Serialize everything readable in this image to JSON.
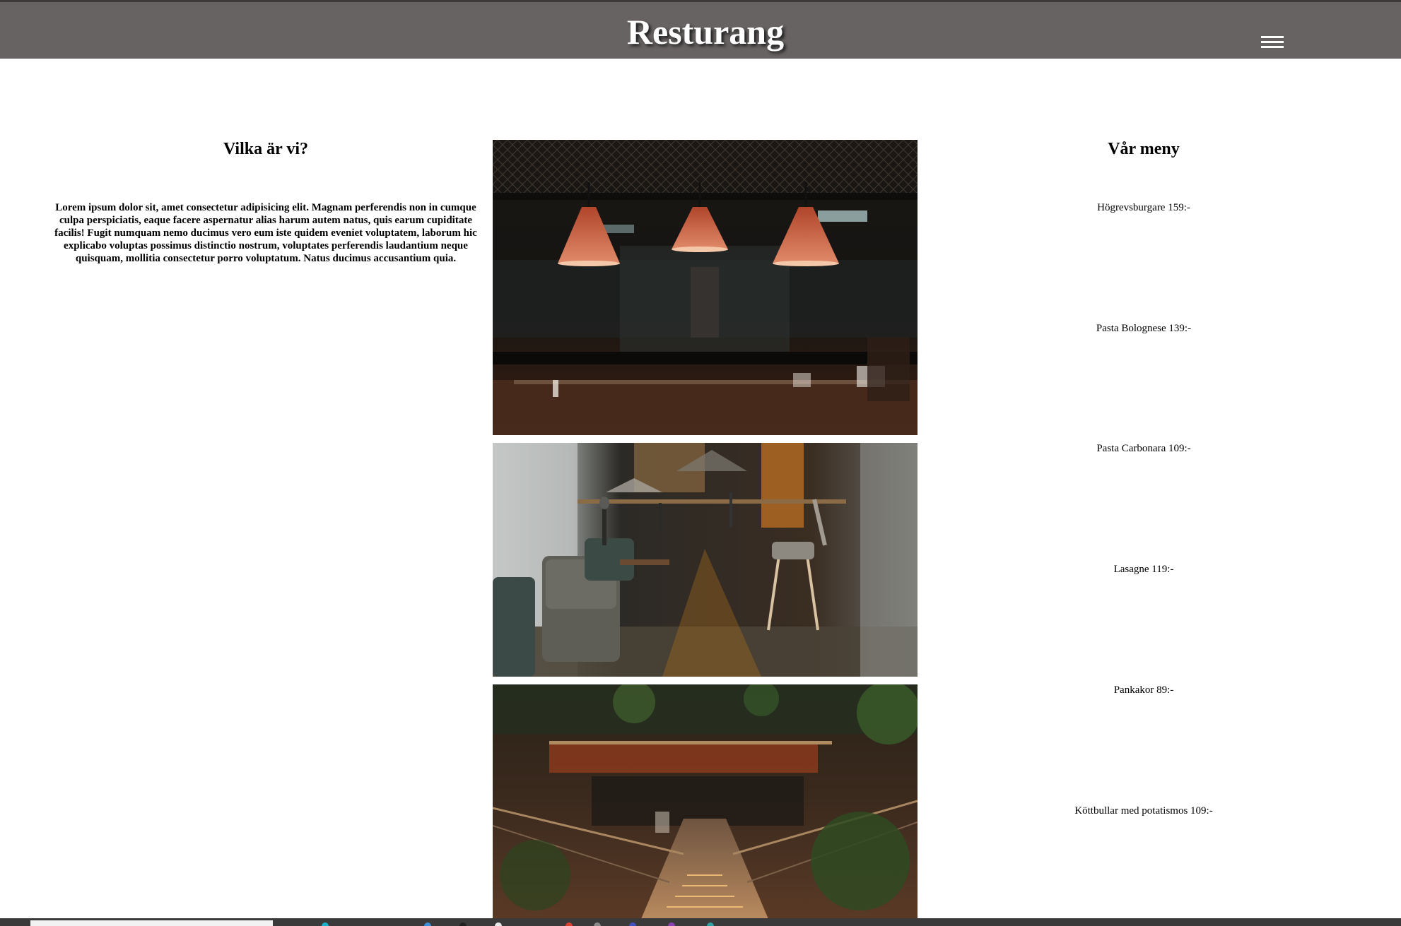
{
  "header": {
    "title": "Resturang",
    "menu_icon": "hamburger-menu-icon",
    "background_color": "#686363"
  },
  "about": {
    "heading": "Vilka är vi?",
    "text": "Lorem ipsum dolor sit, amet consectetur adipisicing elit. Magnam perferendis non in cumque culpa perspiciatis, eaque facere aspernatur alias harum autem natus, quis earum cupiditate facilis! Fugit numquam nemo ducimus vero eum iste quidem eveniet voluptatem, laborum hic explicabo voluptas possimus distinctio nostrum, voluptates perferendis laudantium neque quisquam, mollitia consectetur porro voluptatum. Natus ducimus accusantium quia."
  },
  "gallery": [
    {
      "subject": "restaurant-kitchen-photo"
    },
    {
      "subject": "restaurant-bar-seating-photo"
    },
    {
      "subject": "restaurant-staircase-photo"
    }
  ],
  "menu": {
    "heading": "Vår meny",
    "items": [
      "Högrevsburgare 159:-",
      "Pasta Bolognese 139:-",
      "Pasta Carbonara 109:-",
      "Lasagne 119:-",
      "Pankakor 89:-",
      "Köttbullar med potatismos 109:-"
    ]
  }
}
